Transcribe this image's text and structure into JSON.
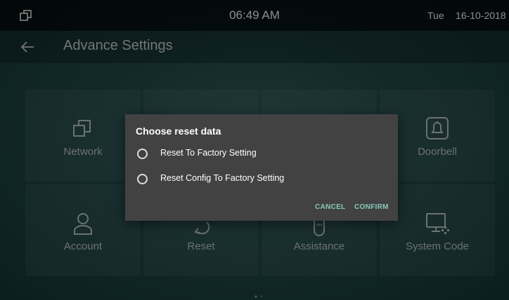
{
  "statusbar": {
    "time": "06:49 AM",
    "day": "Tue",
    "date": "16-10-2018",
    "icon": "window-icon"
  },
  "header": {
    "title": "Advance Settings",
    "back_icon": "back-arrow-icon"
  },
  "tiles": [
    {
      "label": "Network",
      "icon": "network-icon"
    },
    {
      "label": "",
      "icon": ""
    },
    {
      "label": "",
      "icon": ""
    },
    {
      "label": "Doorbell",
      "icon": "doorbell-icon"
    },
    {
      "label": "Account",
      "icon": "account-icon"
    },
    {
      "label": "Reset",
      "icon": "reset-icon"
    },
    {
      "label": "Assistance",
      "icon": "assistance-icon"
    },
    {
      "label": "System Code",
      "icon": "system-code-icon"
    }
  ],
  "dialog": {
    "title": "Choose reset data",
    "options": [
      {
        "label": "Reset To Factory Setting",
        "selected": false
      },
      {
        "label": "Reset Config To Factory Setting",
        "selected": false
      }
    ],
    "cancel_label": "CANCEL",
    "confirm_label": "CONFIRM"
  },
  "colors": {
    "accent": "#86c9b9",
    "dialog_bg": "#424242",
    "statusbar_bg": "#000000"
  }
}
